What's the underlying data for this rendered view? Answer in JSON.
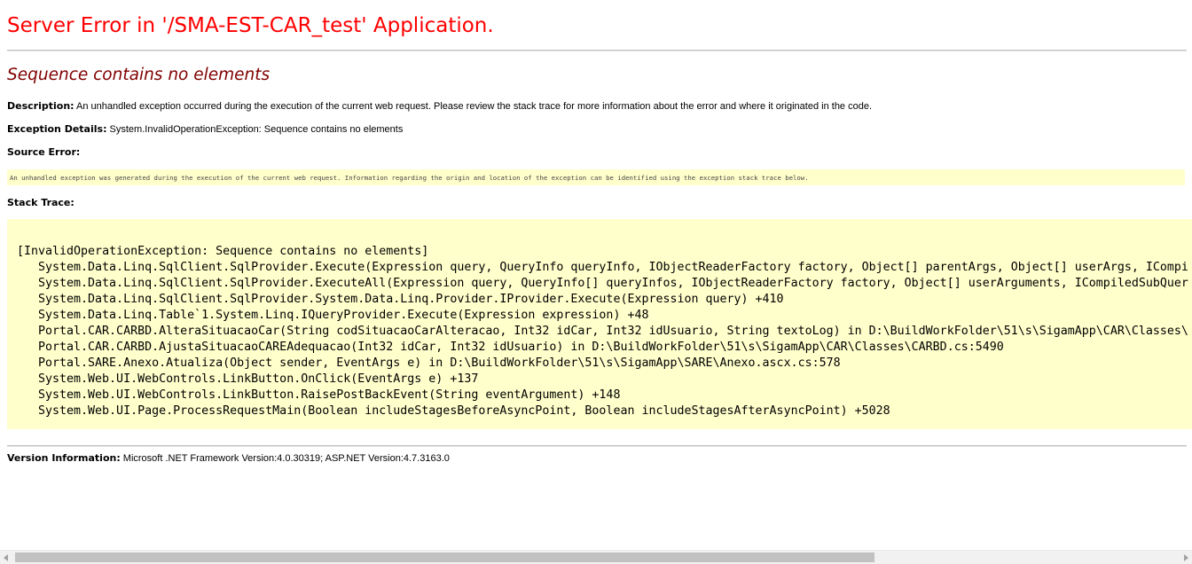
{
  "page": {
    "title": "Server Error in '/SMA-EST-CAR_test' Application.",
    "error_message": "Sequence contains no elements"
  },
  "description": {
    "label": "Description:",
    "text": " An unhandled exception occurred during the execution of the current web request. Please review the stack trace for more information about the error and where it originated in the code."
  },
  "exception_details": {
    "label": "Exception Details:",
    "text": " System.InvalidOperationException: Sequence contains no elements"
  },
  "source_error": {
    "label": "Source Error:",
    "text": "An unhandled exception was generated during the execution of the current web request. Information regarding the origin and location of the exception can be identified using the exception stack trace below."
  },
  "stack_trace": {
    "label": "Stack Trace:",
    "lines": [
      "[InvalidOperationException: Sequence contains no elements]",
      "System.Data.Linq.SqlClient.SqlProvider.Execute(Expression query, QueryInfo queryInfo, IObjectReaderFactory factory, Object[] parentArgs, Object[] userArgs, ICompi",
      "System.Data.Linq.SqlClient.SqlProvider.ExecuteAll(Expression query, QueryInfo[] queryInfos, IObjectReaderFactory factory, Object[] userArguments, ICompiledSubQuer",
      "System.Data.Linq.SqlClient.SqlProvider.System.Data.Linq.Provider.IProvider.Execute(Expression query) +410",
      "System.Data.Linq.Table`1.System.Linq.IQueryProvider.Execute(Expression expression) +48",
      "Portal.CAR.CARBD.AlteraSituacaoCar(String codSituacaoCarAlteracao, Int32 idCar, Int32 idUsuario, String textoLog) in D:\\BuildWorkFolder\\51\\s\\SigamApp\\CAR\\Classes\\",
      "Portal.CAR.CARBD.AjustaSituacaoCAREAdequacao(Int32 idCar, Int32 idUsuario) in D:\\BuildWorkFolder\\51\\s\\SigamApp\\CAR\\Classes\\CARBD.cs:5490",
      "Portal.SARE.Anexo.Atualiza(Object sender, EventArgs e) in D:\\BuildWorkFolder\\51\\s\\SigamApp\\SARE\\Anexo.ascx.cs:578",
      "System.Web.UI.WebControls.LinkButton.OnClick(EventArgs e) +137",
      "System.Web.UI.WebControls.LinkButton.RaisePostBackEvent(String eventArgument) +148",
      "System.Web.UI.Page.ProcessRequestMain(Boolean includeStagesBeforeAsyncPoint, Boolean includeStagesAfterAsyncPoint) +5028"
    ]
  },
  "version_information": {
    "label": "Version Information:",
    "text": " Microsoft .NET Framework Version:4.0.30319; ASP.NET Version:4.7.3163.0"
  },
  "scrollbar": {
    "thumb_fraction": 0.74
  },
  "colors": {
    "title": "#ff0000",
    "error_message": "#800000",
    "code_background": "#ffffcc",
    "rule": "#c0c0c0"
  }
}
